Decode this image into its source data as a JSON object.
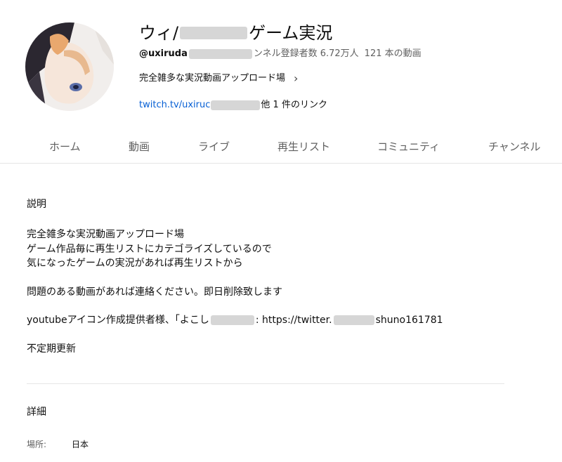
{
  "channel": {
    "title_start": "ウィ/",
    "title_end": "ゲーム実況",
    "handle": "@uxiruda",
    "meta_after_redaction": "ンネル登録者数 6.72万人",
    "video_count": "121 本の動画",
    "tagline": "完全雑多な実況動画アップロード場",
    "link_url": "twitch.tv/uxiruc",
    "link_more": "他 1 件のリンク"
  },
  "tabs": [
    "ホーム",
    "動画",
    "ライブ",
    "再生リスト",
    "コミュニティ",
    "チャンネル"
  ],
  "about": {
    "section_title": "説明",
    "lines_1": [
      "完全雑多な実況動画アップロード場",
      "ゲーム作品毎に再生リストにカテゴライズしているので",
      "気になったゲームの実況があれば再生リストから"
    ],
    "line_2": "問題のある動画があれば連絡ください。即日削除致します",
    "credit_start": "youtubeアイコン作成提供者様、「よこし",
    "credit_mid": ": https://twitter.",
    "credit_end": "shuno161781",
    "line_4": "不定期更新",
    "details_title": "詳細",
    "location_label": "場所:",
    "location_value": "日本"
  }
}
